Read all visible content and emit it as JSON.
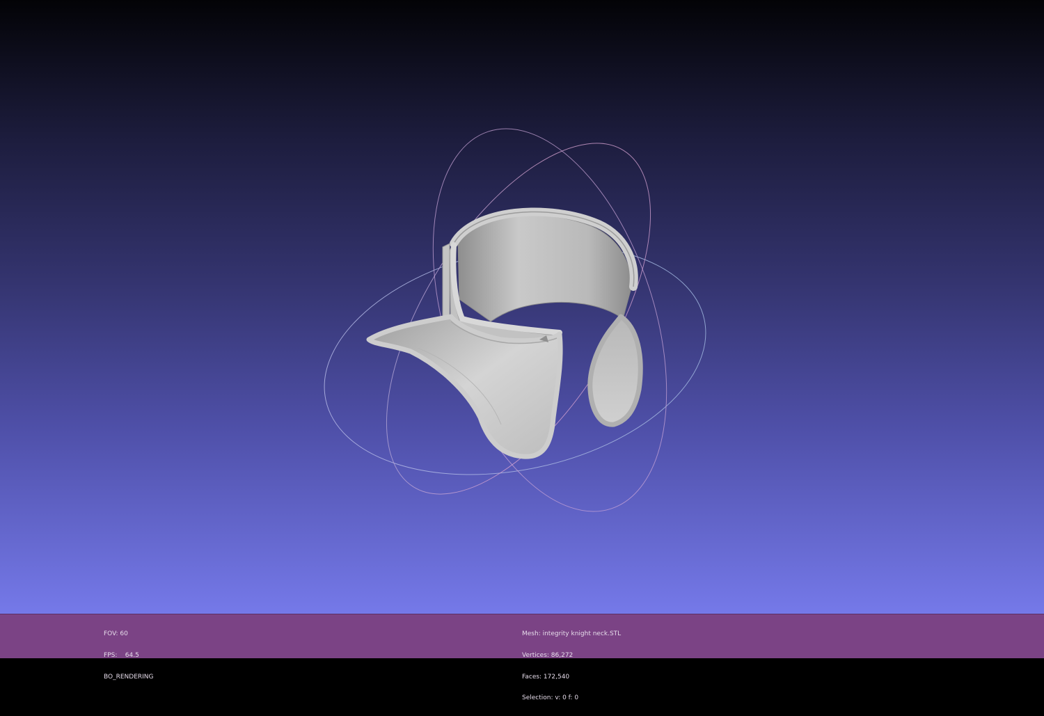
{
  "viewport": {
    "model_name": "integrity knight neck",
    "background_top": "#030306",
    "background_bottom": "#7579e9"
  },
  "statusbar": {
    "background": "#7b4385",
    "render_info": {
      "fov": "FOV: 60",
      "fps": "FPS:    64.5",
      "mode": "BO_RENDERING"
    },
    "mesh_info": {
      "mesh": "Mesh: integrity knight neck.STL",
      "vertices": "Vertices: 86,272",
      "faces": "Faces: 172,540",
      "selection": "Selection: v: 0 f: 0"
    }
  }
}
